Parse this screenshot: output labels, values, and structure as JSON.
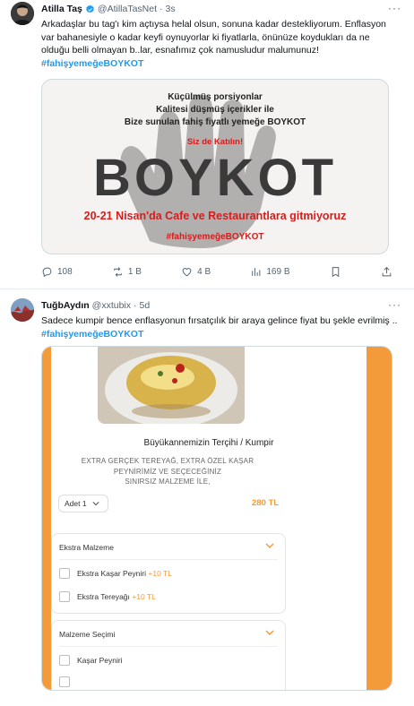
{
  "tweet1": {
    "name": "Atilla Taş",
    "handle": "@AtillaTasNet",
    "time": "3s",
    "text": "Arkadaşlar bu tag'ı kim açtıysa helal olsun, sonuna kadar destekliyorum. Enflasyon var bahanesiyle o kadar keyfi oynuyorlar ki fiyatlarla, önünüze koydukları da ne olduğu belli olmayan b..lar, esnafımız çok namusludur malumunuz!",
    "hashtag": "#fahişyemeğeBOYKOT",
    "image": {
      "line1": "Küçülmüş porsiyonlar",
      "line2": "Kalitesi düşmüş içerikler ile",
      "line3": "Bize sunulan fahiş fiyatlı yemeğe BOYKOT",
      "line4": "Siz de Katılın!",
      "big": "BOYKOT",
      "line6": "20-21 Nisan'da Cafe ve Restaurantlara gitmiyoruz",
      "line7": "#fahişyemeğeBOYKOT"
    },
    "actions": {
      "replies": "108",
      "retweets": "1 B",
      "likes": "4 B",
      "views": "169 B"
    }
  },
  "tweet2": {
    "name": "TuğbAydın",
    "handle": "@xxtubix",
    "time": "5d",
    "text": "Sadece kumpir bence enflasyonun fırsatçılık bir araya gelince fiyat bu şekle evrilmiş ..",
    "hashtag": "#fahişyemeğeBOYKOT",
    "product": {
      "title": "Büyükannemizin Terçihi / Kumpir",
      "desc_line1": "EXTRA GERÇEK TEREYAĞ, EXTRA ÖZEL KAŞAR",
      "desc_line2": "PEYNİRİMİZ VE SEÇECEĞİNİZ",
      "desc_line3": "SINIRSIZ MALZEME İLE,",
      "qty": "Adet 1",
      "price": "280 TL",
      "section1_title": "Ekstra Malzeme",
      "opt1": "Ekstra Kaşar Peyniri",
      "opt1_price": "+10 TL",
      "opt2": "Ekstra Tereyağı",
      "opt2_price": "+10 TL",
      "section2_title": "Malzeme Seçimi",
      "opt3": "Kaşar Peyniri"
    }
  },
  "colors": {
    "link": "#1d9bf0",
    "accent_red": "#d81c1c",
    "accent_orange": "#f39b3a"
  }
}
